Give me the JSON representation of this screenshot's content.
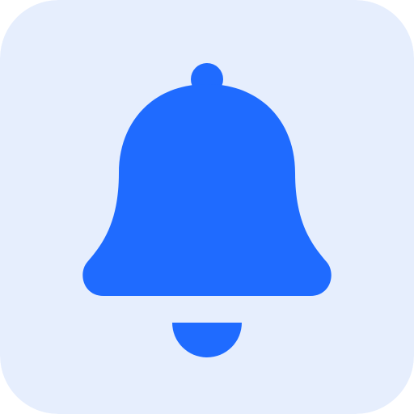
{
  "icon": {
    "name": "bell-icon",
    "background_color": "#e6eefd",
    "glyph_color": "#1f6bff"
  }
}
